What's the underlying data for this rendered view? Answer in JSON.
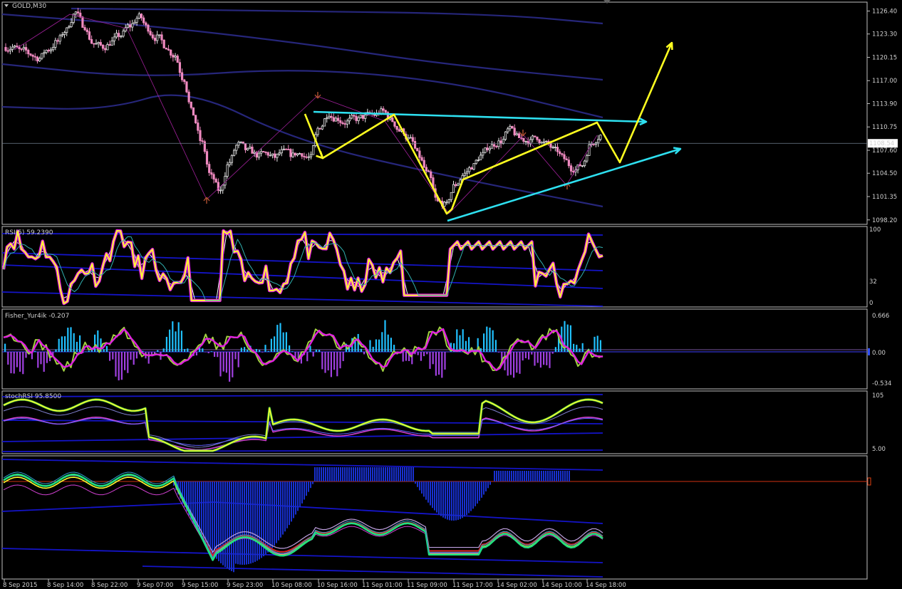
{
  "chart_data": {
    "type": "line",
    "symbol": "GOLD,M30",
    "current_price": "1108.54",
    "price_ticks": [
      "1126.40",
      "1123.30",
      "1120.15",
      "1117.00",
      "1113.90",
      "1110.75",
      "1107.60",
      "1104.50",
      "1101.35",
      "1098.20"
    ],
    "x_ticks": [
      "8 Sep 2015",
      "8 Sep 14:00",
      "8 Sep 22:00",
      "9 Sep 07:00",
      "9 Sep 15:00",
      "9 Sep 23:00",
      "10 Sep 08:00",
      "10 Sep 16:00",
      "11 Sep 01:00",
      "11 Sep 09:00",
      "11 Sep 17:00",
      "14 Sep 02:00",
      "14 Sep 10:00",
      "14 Sep 18:00"
    ],
    "price_series": [
      1121.5,
      1121.0,
      1120.6,
      1120.0,
      1121.2,
      1122.3,
      1123.8,
      1126.2,
      1124.3,
      1122.0,
      1121.6,
      1122.2,
      1123.1,
      1124.4,
      1125.6,
      1124.1,
      1122.8,
      1121.6,
      1120.4,
      1117.2,
      1112.5,
      1108.5,
      1104.0,
      1102.0,
      1106.0,
      1108.4,
      1107.5,
      1107.0,
      1107.2,
      1106.7,
      1107.4,
      1106.9,
      1107.2,
      1106.6,
      1110.8,
      1112.6,
      1111.9,
      1111.4,
      1111.9,
      1112.1,
      1112.4,
      1112.9,
      1111.6,
      1110.2,
      1109.0,
      1106.8,
      1104.3,
      1100.6,
      1100.2,
      1103.0,
      1104.4,
      1105.5,
      1107.0,
      1108.2,
      1108.8,
      1110.4,
      1109.3,
      1108.9,
      1109.4,
      1108.5,
      1107.6,
      1106.5,
      1105.1,
      1105.6,
      1108.5,
      1109.6
    ],
    "yellow_path": [
      [
        428,
        160
      ],
      [
        453,
        222
      ],
      [
        553,
        161
      ],
      [
        627,
        300
      ],
      [
        634,
        294
      ],
      [
        650,
        252
      ],
      [
        838,
        172
      ],
      [
        870,
        228
      ],
      [
        943,
        60
      ]
    ],
    "cyan_lines": [
      [
        [
          440,
          157
        ],
        [
          907,
          171
        ]
      ],
      [
        [
          628,
          310
        ],
        [
          955,
          209
        ]
      ]
    ],
    "panels": [
      {
        "name": "RSI(5) 59.2390",
        "ticks": [
          "100",
          "32",
          "0"
        ]
      },
      {
        "name": "Fisher_Yur4ik -0.207",
        "ticks": [
          "0.666",
          "0.00",
          "-0.534"
        ]
      },
      {
        "name": "stochRSI 95.8500 ",
        "ticks": [
          "105",
          "5.00"
        ]
      },
      {
        "name": "",
        "ticks": []
      }
    ]
  },
  "ui": {
    "symbol_label": "GOLD,M30"
  }
}
